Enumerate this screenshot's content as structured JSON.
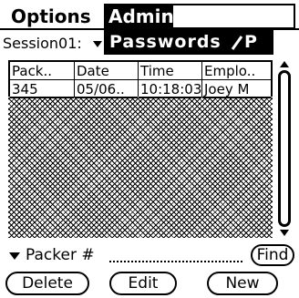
{
  "menubar": {
    "options_label": "Options",
    "admin_label": "Admin"
  },
  "admin_menu": {
    "items": [
      {
        "label": "Passwords",
        "shortcut_glyph": "/",
        "shortcut_letter": "P"
      }
    ]
  },
  "session": {
    "label": "Session01:"
  },
  "table": {
    "columns": [
      "Pack..",
      "Date",
      "Time",
      "Emplo.."
    ],
    "rows": [
      [
        "345",
        "05/06..",
        "10:18:03",
        "Joey M"
      ]
    ]
  },
  "packer": {
    "label": "Packer #",
    "value": "",
    "find_label": "Find"
  },
  "buttons": {
    "delete_label": "Delete",
    "edit_label": "Edit",
    "new_label": "New"
  }
}
